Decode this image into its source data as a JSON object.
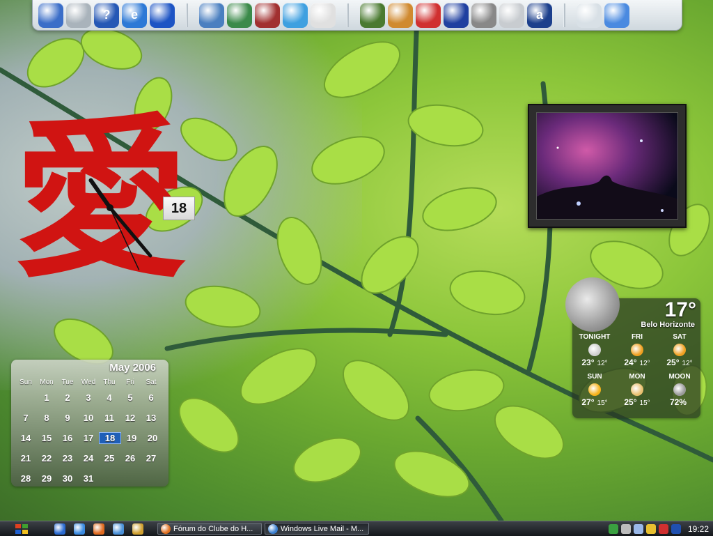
{
  "dock": {
    "icons": [
      {
        "name": "my-computer-icon",
        "color": "#3b6ec8"
      },
      {
        "name": "network-icon",
        "color": "#a9b3bb"
      },
      {
        "name": "help-icon",
        "color": "#2558b5",
        "glyph": "?"
      },
      {
        "name": "internet-explorer-icon",
        "color": "#2d79d6",
        "glyph": "e"
      },
      {
        "name": "bluetooth-icon",
        "color": "#1d54c4"
      },
      {
        "name": "separator"
      },
      {
        "name": "file-manager-icon",
        "color": "#4a7fc0"
      },
      {
        "name": "photo-viewer-icon",
        "color": "#3b8a4a"
      },
      {
        "name": "media-icon",
        "color": "#a13030"
      },
      {
        "name": "messenger-icon",
        "color": "#3fa0e0"
      },
      {
        "name": "media-player-icon",
        "color": "#e0e0e0"
      },
      {
        "name": "separator"
      },
      {
        "name": "settings-gear-icon",
        "color": "#4a7a30"
      },
      {
        "name": "users-icon",
        "color": "#d08a30"
      },
      {
        "name": "antivirus-icon",
        "color": "#d03030"
      },
      {
        "name": "info-icon",
        "color": "#2040a0"
      },
      {
        "name": "yahoo-widgets-icon",
        "color": "#888888"
      },
      {
        "name": "mail-icon",
        "color": "#c8ccd0"
      },
      {
        "name": "amazon-icon",
        "color": "#1c3f8c",
        "glyph": "a"
      },
      {
        "name": "separator"
      },
      {
        "name": "recycle-bin-icon",
        "color": "#d8e0e6"
      },
      {
        "name": "clock-app-icon",
        "color": "#4a8ae0"
      }
    ]
  },
  "kanji_clock": {
    "kanji": "愛",
    "date": "18",
    "hands": {
      "hour_deg": -35,
      "minute_deg": 140,
      "second_deg": 155
    }
  },
  "weather": {
    "temperature": "17°",
    "city": "Belo Horizonte",
    "forecast": [
      {
        "label": "TONIGHT",
        "high": "23°",
        "low": "12°",
        "icon": "moon-icon",
        "icon_color": "#cfcfcf"
      },
      {
        "label": "FRI",
        "high": "24°",
        "low": "12°",
        "icon": "sunny-icon",
        "icon_color": "#f0a020"
      },
      {
        "label": "SAT",
        "high": "25°",
        "low": "12°",
        "icon": "sunny-icon",
        "icon_color": "#f0a020"
      },
      {
        "label": "SUN",
        "high": "27°",
        "low": "15°",
        "icon": "sunny-icon",
        "icon_color": "#f6b21a"
      },
      {
        "label": "MON",
        "high": "25°",
        "low": "15°",
        "icon": "partly-cloudy-icon",
        "icon_color": "#e8c070"
      },
      {
        "label": "MOON",
        "high": "72%",
        "low": "",
        "icon": "moon-phase-icon",
        "icon_color": "#9a9a9a"
      }
    ]
  },
  "calendar": {
    "title": "May 2006",
    "weekdays": [
      "Sun",
      "Mon",
      "Tue",
      "Wed",
      "Thu",
      "Fri",
      "Sat"
    ],
    "weeks": [
      [
        "",
        "1",
        "2",
        "3",
        "4",
        "5",
        "6"
      ],
      [
        "7",
        "8",
        "9",
        "10",
        "11",
        "12",
        "13"
      ],
      [
        "14",
        "15",
        "16",
        "17",
        "18",
        "19",
        "20"
      ],
      [
        "21",
        "22",
        "23",
        "24",
        "25",
        "26",
        "27"
      ],
      [
        "28",
        "29",
        "30",
        "31",
        "",
        "",
        ""
      ]
    ],
    "today": "18"
  },
  "taskbar": {
    "tasks": [
      {
        "label": "Fórum do Clube do H...",
        "icon_color": "#e07020",
        "active": false
      },
      {
        "label": "Windows Live Mail - M...",
        "icon_color": "#3a7fd0",
        "active": true
      }
    ],
    "quick_launch_colors": [
      "#2a6ad0",
      "#3a8ae0",
      "#e06a20",
      "#4a90d8",
      "#d0a030"
    ],
    "tray_colors": [
      "#3aa040",
      "#bcbcbc",
      "#9ab8e8",
      "#e8c030",
      "#d03030",
      "#2050b0"
    ],
    "clock": "19:22"
  }
}
